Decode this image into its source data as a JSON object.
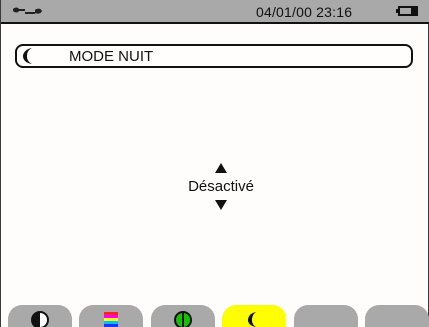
{
  "status": {
    "datetime": "04/01/00 23:16",
    "icon_left": "wrench-key-icon",
    "icon_right": "battery-icon"
  },
  "title": {
    "icon": "moon-icon",
    "text": "MODE NUIT"
  },
  "selector": {
    "value": "Désactivé",
    "up_icon": "triangle-up-icon",
    "down_icon": "triangle-down-icon"
  },
  "tabs": [
    {
      "icon": "contrast-icon",
      "active": false
    },
    {
      "icon": "color-bars-icon",
      "active": false
    },
    {
      "icon": "power-green-icon",
      "active": false
    },
    {
      "icon": "moon-icon",
      "active": true
    },
    {
      "icon": "",
      "active": false
    },
    {
      "icon": "",
      "active": false
    }
  ],
  "colors": {
    "statusbar": "#a9a9a9",
    "active_tab": "#ffff00",
    "inactive_tab": "#a9a9a9",
    "green": "#19c000"
  }
}
